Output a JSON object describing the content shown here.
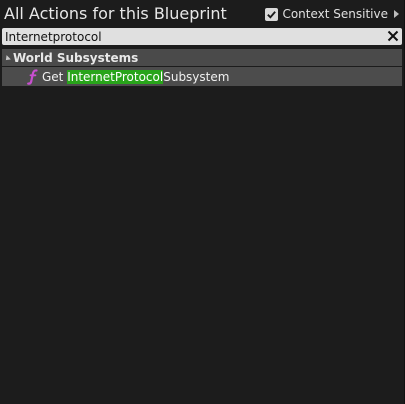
{
  "header": {
    "title": "All Actions for this Blueprint",
    "context_sensitive_label": "Context Sensitive",
    "context_sensitive_checked": true
  },
  "search": {
    "value": "Internetprotocol"
  },
  "results": {
    "category": "World Subsystems",
    "items": [
      {
        "prefix": "Get ",
        "match": "InternetProtocol",
        "suffix": "Subsystem",
        "icon": "function-icon"
      }
    ]
  },
  "colors": {
    "background": "#1c1c1c",
    "highlight": "#28a41a",
    "function_icon": "#c84fd0"
  }
}
